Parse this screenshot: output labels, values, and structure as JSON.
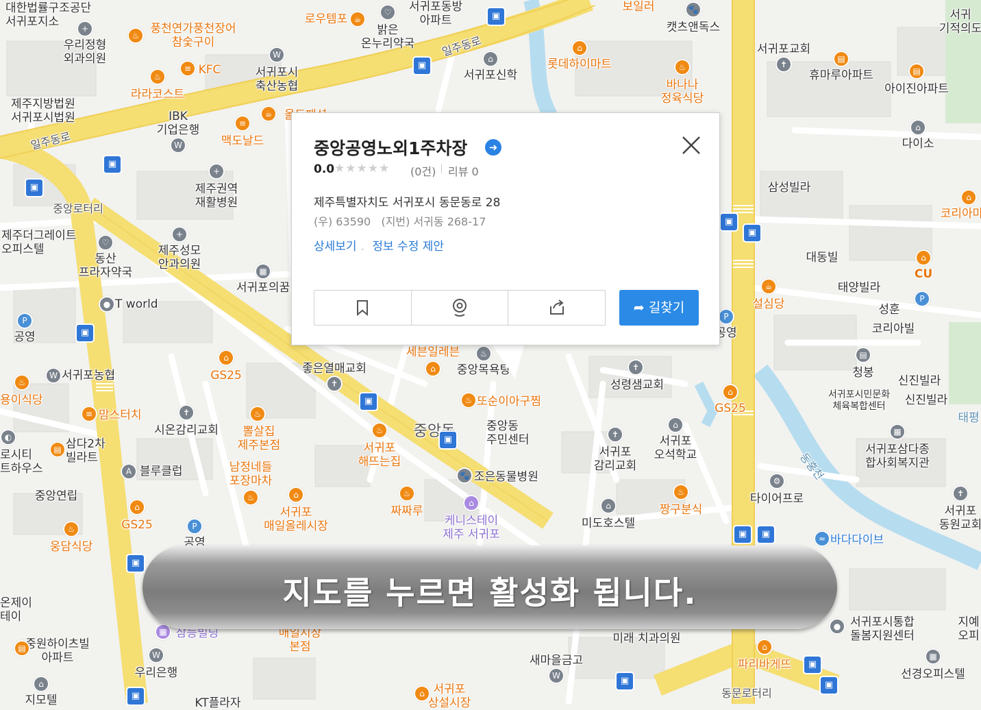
{
  "map": {
    "roads": {
      "iljudong_ro_1": "일주동로",
      "iljudong_ro_2": "일주동로",
      "jungang_rotary": "중앙로터리",
      "dongmun_rotary": "동문로터리",
      "donghongcheon": "동홍천"
    },
    "places": [
      {
        "id": "court-legal",
        "text": "대한법률구조공단\n서귀포지소",
        "tone": "dark"
      },
      {
        "id": "urijeong",
        "text": "우리정형\n외과의원",
        "tone": "dark"
      },
      {
        "id": "pungcheon",
        "text": "풍천연가풍천장어\n참숯구이",
        "tone": "orange"
      },
      {
        "id": "routemp",
        "text": "로우템포",
        "tone": "orange"
      },
      {
        "id": "balgeun",
        "text": "밝은\n온누리약국",
        "tone": "dark"
      },
      {
        "id": "seogwipo-dong-apt",
        "text": "서귀포동방\n아파트",
        "tone": "dark"
      },
      {
        "id": "boiler",
        "text": "보일러",
        "tone": "orange"
      },
      {
        "id": "cats-dogs",
        "text": "캣츠앤독스",
        "tone": "dark"
      },
      {
        "id": "seogwipo-church",
        "text": "서귀포교회",
        "tone": "dark"
      },
      {
        "id": "miracle",
        "text": "서귀\n기적의도",
        "tone": "dark"
      },
      {
        "id": "kfc",
        "text": "KFC",
        "tone": "orange"
      },
      {
        "id": "livestock",
        "text": "서귀포시\n축산농협",
        "tone": "dark"
      },
      {
        "id": "seogwipo-sinhak",
        "text": "서귀포신학",
        "tone": "dark"
      },
      {
        "id": "lotte-mart",
        "text": "롯데하이마트",
        "tone": "orange"
      },
      {
        "id": "humaru",
        "text": "휴마루아파트",
        "tone": "dark"
      },
      {
        "id": "aijin",
        "text": "아이진아파트",
        "tone": "dark"
      },
      {
        "id": "banana",
        "text": "바나나\n정육식당",
        "tone": "orange"
      },
      {
        "id": "court",
        "text": "제주지방법원\n서귀포시법원",
        "tone": "dark"
      },
      {
        "id": "lalacost",
        "text": "라라코스트",
        "tone": "orange"
      },
      {
        "id": "ibk",
        "text": "IBK\n기업은행",
        "tone": "dark"
      },
      {
        "id": "ol",
        "text": "올드패션",
        "tone": "orange"
      },
      {
        "id": "mcdonalds",
        "text": "맥도날드",
        "tone": "orange"
      },
      {
        "id": "daiso",
        "text": "다이소",
        "tone": "dark"
      },
      {
        "id": "rehab",
        "text": "제주권역\n재활병원",
        "tone": "dark"
      },
      {
        "id": "samsung-villa",
        "text": "삼성빌라",
        "tone": "dark"
      },
      {
        "id": "korea-right",
        "text": "코리아마",
        "tone": "orange"
      },
      {
        "id": "the-great",
        "text": "제주더그레이트\n오피스텔",
        "tone": "dark"
      },
      {
        "id": "dongsan",
        "text": "동산\n프라자약국",
        "tone": "dark"
      },
      {
        "id": "seongmo",
        "text": "제주성모\n안과의원",
        "tone": "dark"
      },
      {
        "id": "seogwipo-uikkum",
        "text": "서귀포의꿈",
        "tone": "dark"
      },
      {
        "id": "daedong",
        "text": "대동빌",
        "tone": "dark"
      },
      {
        "id": "cu",
        "text": "CU",
        "tone": "orange"
      },
      {
        "id": "taeyang",
        "text": "태양빌라",
        "tone": "dark"
      },
      {
        "id": "seolsimdang",
        "text": "설심당",
        "tone": "orange"
      },
      {
        "id": "seonghun",
        "text": "성훈",
        "tone": "dark"
      },
      {
        "id": "korea-villa",
        "text": "코리아빌",
        "tone": "dark"
      },
      {
        "id": "tworld",
        "text": "T world",
        "tone": "dark"
      },
      {
        "id": "parking-left",
        "text": "공영",
        "tone": "dark"
      },
      {
        "id": "parking-right",
        "text": "공영",
        "tone": "dark"
      },
      {
        "id": "seogwipo-nonghyup",
        "text": "서귀포농협",
        "tone": "dark"
      },
      {
        "id": "gs25-1",
        "text": "GS25",
        "tone": "orange"
      },
      {
        "id": "seven",
        "text": "세븐일레븐",
        "tone": "orange"
      },
      {
        "id": "jungang-bath",
        "text": "중앙목욕탕",
        "tone": "dark"
      },
      {
        "id": "joeun-church",
        "text": "좋은열매교회",
        "tone": "dark"
      },
      {
        "id": "seongnyeong",
        "text": "성령샘교회",
        "tone": "dark"
      },
      {
        "id": "cheongbong",
        "text": "청봉",
        "tone": "dark"
      },
      {
        "id": "sinjin1",
        "text": "신진빌라",
        "tone": "dark"
      },
      {
        "id": "sinjin2",
        "text": "신진빌라",
        "tone": "dark"
      },
      {
        "id": "culture-center",
        "text": "서귀포시민문화\n체육복합센터",
        "tone": "dark"
      },
      {
        "id": "yongi",
        "text": "용이식당",
        "tone": "orange"
      },
      {
        "id": "momstouch",
        "text": "맘스터치",
        "tone": "orange"
      },
      {
        "id": "sion-church",
        "text": "시온감리교회",
        "tone": "dark"
      },
      {
        "id": "ppeolsal",
        "text": "뽈살집\n제주본점",
        "tone": "orange"
      },
      {
        "id": "ddosuni",
        "text": "또순이아구찜",
        "tone": "orange"
      },
      {
        "id": "jungang-dong-label",
        "text": "중앙동",
        "tone": "dark"
      },
      {
        "id": "jungang-center",
        "text": "중앙동\n주민센터",
        "tone": "dark"
      },
      {
        "id": "gs25-2",
        "text": "GS25",
        "tone": "orange"
      },
      {
        "id": "taepyeong",
        "text": "태평",
        "tone": "dark"
      },
      {
        "id": "city-house",
        "text": "로시티\n트하우스",
        "tone": "dark"
      },
      {
        "id": "samda2",
        "text": "삼다2차\n빌라트",
        "tone": "dark"
      },
      {
        "id": "blue-club",
        "text": "블루클럽",
        "tone": "dark"
      },
      {
        "id": "namjeong",
        "text": "남정네들\n포장마차",
        "tone": "orange"
      },
      {
        "id": "haedtteun",
        "text": "서귀포\n해뜨는집",
        "tone": "orange"
      },
      {
        "id": "seogwipo-gamri",
        "text": "서귀포\n감리교회",
        "tone": "dark"
      },
      {
        "id": "ojeon-school",
        "text": "서귀포\n오석학교",
        "tone": "dark"
      },
      {
        "id": "samda-welfare",
        "text": "서귀포삼다종\n합사회복지관",
        "tone": "dark"
      },
      {
        "id": "jungang-villa",
        "text": "중앙연립",
        "tone": "dark"
      },
      {
        "id": "joeun-animal",
        "text": "조은동물병원",
        "tone": "dark"
      },
      {
        "id": "tire-pro",
        "text": "타이어프로",
        "tone": "dark"
      },
      {
        "id": "maeil-market",
        "text": "서귀포\n매일올레시장",
        "tone": "orange"
      },
      {
        "id": "jjajjaru",
        "text": "짜짜루",
        "tone": "orange"
      },
      {
        "id": "kennedy",
        "text": "케니스테이\n제주 서귀포",
        "tone": "purple"
      },
      {
        "id": "jjanggu",
        "text": "짱구분식",
        "tone": "orange"
      },
      {
        "id": "mido-hotel",
        "text": "미도호스텔",
        "tone": "dark"
      },
      {
        "id": "dongwon-church",
        "text": "서귀포\n동원교회",
        "tone": "dark"
      },
      {
        "id": "gs25-3",
        "text": "GS25",
        "tone": "orange"
      },
      {
        "id": "parking-bottom",
        "text": "공영",
        "tone": "dark"
      },
      {
        "id": "woodam",
        "text": "웅담식당",
        "tone": "orange"
      },
      {
        "id": "bada-dive",
        "text": "바다다이브",
        "tone": "blue"
      },
      {
        "id": "eon-j",
        "text": "온제이\n테이",
        "tone": "dark"
      },
      {
        "id": "samdeung",
        "text": "삼등빌딩",
        "tone": "purple"
      },
      {
        "id": "maeil-main",
        "text": "매일시장\n본점",
        "tone": "orange"
      },
      {
        "id": "mirae-dental",
        "text": "미래 치과의원",
        "tone": "dark"
      },
      {
        "id": "care-center",
        "text": "서귀포시통합\n돌봄지원센터",
        "tone": "dark"
      },
      {
        "id": "jiye",
        "text": "지예\n오피",
        "tone": "dark"
      },
      {
        "id": "jungwon-apt",
        "text": "중원하이츠빌\n아파트",
        "tone": "dark"
      },
      {
        "id": "woori-bank",
        "text": "우리은행",
        "tone": "dark"
      },
      {
        "id": "saemaeul",
        "text": "새마을금고",
        "tone": "dark"
      },
      {
        "id": "paris",
        "text": "파리바게뜨",
        "tone": "orange"
      },
      {
        "id": "seongyeong",
        "text": "선경오피스텔",
        "tone": "dark"
      },
      {
        "id": "jimotel",
        "text": "지모텔",
        "tone": "dark"
      },
      {
        "id": "kt",
        "text": "KT플라자",
        "tone": "dark"
      },
      {
        "id": "sangseol-market",
        "text": "서귀포\n상설시장",
        "tone": "orange"
      }
    ]
  },
  "popup": {
    "title": "중앙공영노외1주차장",
    "rating": "0.0",
    "stars": "★★★★★",
    "rating_count": "(0건)",
    "review": "리뷰 0",
    "address": "제주특별자치도 서귀포시 동문동로 28",
    "zip_jibun": "(우) 63590   (지번) 서귀동 268-17",
    "link_detail": "상세보기",
    "link_edit": "정보 수정 제안",
    "route_label": "길찾기",
    "colors": {
      "accent": "#2a8ae6",
      "link": "#2a7ad5"
    }
  },
  "banner": {
    "text": "지도를 누르면 활성화 됩니다."
  }
}
